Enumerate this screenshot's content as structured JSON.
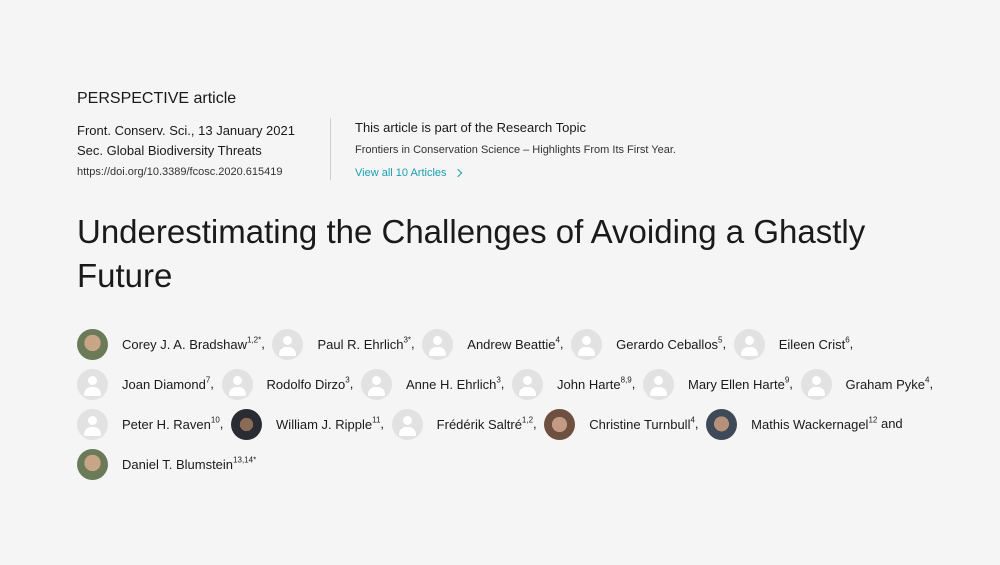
{
  "article_type": "PERSPECTIVE article",
  "meta": {
    "journal_date": "Front. Conserv. Sci., 13 January 2021",
    "section": "Sec. Global Biodiversity Threats",
    "doi": "https://doi.org/10.3389/fcosc.2020.615419"
  },
  "research_topic": {
    "intro": "This article is part of the Research Topic",
    "name": "Frontiers in Conservation Science – Highlights From Its First Year.",
    "view_all": "View all 10 Articles"
  },
  "title": "Underestimating the Challenges of Avoiding a Ghastly Future",
  "authors": [
    {
      "name": "Corey J. A. Bradshaw",
      "sup": "1,2*",
      "avatar": "photo-a",
      "sep": ","
    },
    {
      "name": "Paul R. Ehrlich",
      "sup": "3*",
      "avatar": "placeholder",
      "sep": ","
    },
    {
      "name": "Andrew Beattie",
      "sup": "4",
      "avatar": "placeholder",
      "sep": ","
    },
    {
      "name": "Gerardo Ceballos",
      "sup": "5",
      "avatar": "placeholder",
      "sep": ","
    },
    {
      "name": "Eileen Crist",
      "sup": "6",
      "avatar": "placeholder",
      "sep": ","
    },
    {
      "name": "Joan Diamond",
      "sup": "7",
      "avatar": "placeholder",
      "sep": ","
    },
    {
      "name": "Rodolfo Dirzo",
      "sup": "3",
      "avatar": "placeholder",
      "sep": ","
    },
    {
      "name": "Anne H. Ehrlich",
      "sup": "3",
      "avatar": "placeholder",
      "sep": ","
    },
    {
      "name": "John Harte",
      "sup": "8,9",
      "avatar": "placeholder",
      "sep": ","
    },
    {
      "name": "Mary Ellen Harte",
      "sup": "9",
      "avatar": "placeholder",
      "sep": ","
    },
    {
      "name": "Graham Pyke",
      "sup": "4",
      "avatar": "placeholder",
      "sep": ","
    },
    {
      "name": "Peter H. Raven",
      "sup": "10",
      "avatar": "placeholder",
      "sep": ","
    },
    {
      "name": "William J. Ripple",
      "sup": "11",
      "avatar": "photo-b",
      "sep": ","
    },
    {
      "name": "Frédérik Saltré",
      "sup": "1,2",
      "avatar": "placeholder",
      "sep": ","
    },
    {
      "name": "Christine Turnbull",
      "sup": "4",
      "avatar": "photo-c",
      "sep": ","
    },
    {
      "name": "Mathis Wackernagel",
      "sup": "12",
      "avatar": "photo-d",
      "sep": " and"
    },
    {
      "name": "Daniel T. Blumstein",
      "sup": "13,14*",
      "avatar": "photo-a",
      "sep": ""
    }
  ],
  "colors": {
    "background": "#f5f5f5",
    "link": "#1a9fb0",
    "text": "#1a1a1a"
  }
}
